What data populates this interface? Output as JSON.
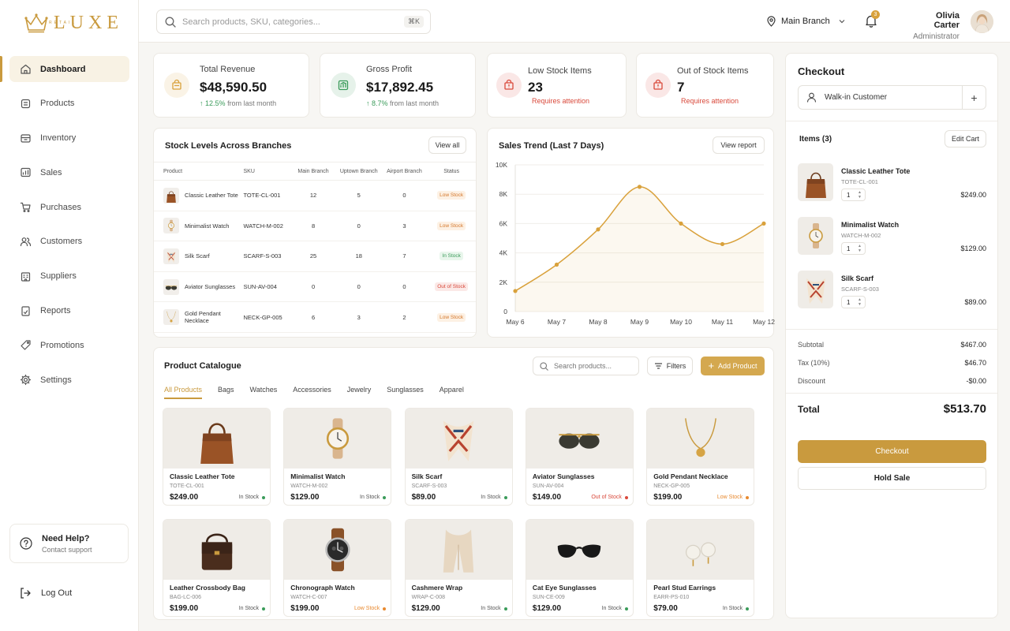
{
  "brand": {
    "name": "LUXE",
    "sub": "RETAIL",
    "color": "#c99a3e"
  },
  "sidebar": {
    "items": [
      {
        "label": "Dashboard",
        "icon": "home-icon",
        "active": true
      },
      {
        "label": "Products",
        "icon": "box-icon"
      },
      {
        "label": "Inventory",
        "icon": "inventory-icon"
      },
      {
        "label": "Sales",
        "icon": "sales-icon"
      },
      {
        "label": "Purchases",
        "icon": "cart-icon"
      },
      {
        "label": "Customers",
        "icon": "users-icon"
      },
      {
        "label": "Suppliers",
        "icon": "building-icon"
      },
      {
        "label": "Reports",
        "icon": "report-icon"
      },
      {
        "label": "Promotions",
        "icon": "tag-icon"
      },
      {
        "label": "Settings",
        "icon": "gear-icon"
      }
    ],
    "help_title": "Need Help?",
    "help_sub": "Contact support",
    "logout": "Log Out"
  },
  "topbar": {
    "search_placeholder": "Search products, SKU, categories...",
    "shortcut": "⌘K",
    "branch": "Main Branch",
    "notifications": "3",
    "user_name": "Olivia Carter",
    "user_role": "Administrator"
  },
  "kpis": [
    {
      "label": "Total Revenue",
      "value": "$48,590.50",
      "change": "12.5%",
      "change_text": "from last month",
      "color": "#d9a13b"
    },
    {
      "label": "Gross Profit",
      "value": "$17,892.45",
      "change": "8.7%",
      "change_text": "from last month",
      "color": "#3a9b5a"
    },
    {
      "label": "Low Stock Items",
      "value": "23",
      "warn": "Requires attention",
      "color": "#d9493b"
    },
    {
      "label": "Out of Stock Items",
      "value": "7",
      "warn": "Requires attention",
      "color": "#d9493b"
    }
  ],
  "stock": {
    "title": "Stock Levels Across Branches",
    "view_all": "View all",
    "headers": [
      "Product",
      "SKU",
      "Main Branch",
      "Uptown Branch",
      "Airport Branch",
      "Status"
    ],
    "rows": [
      {
        "product": "Classic Leather Tote",
        "sku": "TOTE-CL-001",
        "main": "12",
        "uptown": "5",
        "airport": "0",
        "status": "Low Stock",
        "kind": "low",
        "icon": "tote-icon"
      },
      {
        "product": "Minimalist Watch",
        "sku": "WATCH-M-002",
        "main": "8",
        "uptown": "0",
        "airport": "3",
        "status": "Low Stock",
        "kind": "low",
        "icon": "watch-icon"
      },
      {
        "product": "Silk Scarf",
        "sku": "SCARF-S-003",
        "main": "25",
        "uptown": "18",
        "airport": "7",
        "status": "In Stock",
        "kind": "in",
        "icon": "scarf-icon"
      },
      {
        "product": "Aviator Sunglasses",
        "sku": "SUN-AV-004",
        "main": "0",
        "uptown": "0",
        "airport": "0",
        "status": "Out of Stock",
        "kind": "out",
        "icon": "sunglasses-icon"
      },
      {
        "product": "Gold Pendant Necklace",
        "sku": "NECK-GP-005",
        "main": "6",
        "uptown": "3",
        "airport": "2",
        "status": "Low Stock",
        "kind": "low",
        "icon": "necklace-icon"
      }
    ]
  },
  "trend": {
    "title": "Sales Trend (Last 7 Days)",
    "view_report": "View report"
  },
  "chart_data": {
    "type": "line",
    "title": "Sales Trend (Last 7 Days)",
    "categories": [
      "May 6",
      "May 7",
      "May 8",
      "May 9",
      "May 10",
      "May 11",
      "May 12"
    ],
    "values": [
      1400,
      3200,
      5600,
      8500,
      6000,
      4600,
      6000
    ],
    "y_ticks": [
      "0",
      "2K",
      "4K",
      "6K",
      "8K",
      "10K"
    ],
    "ylim": [
      0,
      10000
    ],
    "color": "#d9a13b",
    "grid": true
  },
  "catalogue": {
    "title": "Product Catalogue",
    "search_placeholder": "Search products...",
    "filters": "Filters",
    "add": "Add Product",
    "tabs": [
      "All Products",
      "Bags",
      "Watches",
      "Accessories",
      "Jewelry",
      "Sunglasses",
      "Apparel"
    ],
    "products": [
      {
        "name": "Classic Leather Tote",
        "sku": "TOTE-CL-001",
        "price": "$249.00",
        "status": "In Stock",
        "kind": "in",
        "icon": "tote-icon"
      },
      {
        "name": "Minimalist Watch",
        "sku": "WATCH-M-002",
        "price": "$129.00",
        "status": "In Stock",
        "kind": "in",
        "icon": "watch-icon"
      },
      {
        "name": "Silk Scarf",
        "sku": "SCARF-S-003",
        "price": "$89.00",
        "status": "In Stock",
        "kind": "in",
        "icon": "scarf-icon"
      },
      {
        "name": "Aviator Sunglasses",
        "sku": "SUN-AV-004",
        "price": "$149.00",
        "status": "Out of Stock",
        "kind": "out",
        "icon": "sunglasses-icon"
      },
      {
        "name": "Gold Pendant Necklace",
        "sku": "NECK-GP-005",
        "price": "$199.00",
        "status": "Low Stock",
        "kind": "low",
        "icon": "necklace-icon"
      },
      {
        "name": "Leather Crossbody Bag",
        "sku": "BAG-LC-006",
        "price": "$199.00",
        "status": "In Stock",
        "kind": "in",
        "icon": "crossbody-bag-icon"
      },
      {
        "name": "Chronograph Watch",
        "sku": "WATCH-C-007",
        "price": "$199.00",
        "status": "Low Stock",
        "kind": "low",
        "icon": "chronograph-icon"
      },
      {
        "name": "Cashmere Wrap",
        "sku": "WRAP-C-008",
        "price": "$129.00",
        "status": "In Stock",
        "kind": "in",
        "icon": "wrap-icon"
      },
      {
        "name": "Cat Eye Sunglasses",
        "sku": "SUN-CE-009",
        "price": "$129.00",
        "status": "In Stock",
        "kind": "in",
        "icon": "cat-eye-icon"
      },
      {
        "name": "Pearl Stud Earrings",
        "sku": "EARR-PS-010",
        "price": "$79.00",
        "status": "In Stock",
        "kind": "in",
        "icon": "earrings-icon"
      }
    ]
  },
  "checkout": {
    "title": "Checkout",
    "customer": "Walk-in Customer",
    "items_label": "Items (3)",
    "edit_cart": "Edit Cart",
    "items": [
      {
        "name": "Classic Leather Tote",
        "sku": "TOTE-CL-001",
        "qty": "1",
        "price": "$249.00",
        "icon": "tote-icon"
      },
      {
        "name": "Minimalist Watch",
        "sku": "WATCH-M-002",
        "qty": "1",
        "price": "$129.00",
        "icon": "watch-icon"
      },
      {
        "name": "Silk Scarf",
        "sku": "SCARF-S-003",
        "qty": "1",
        "price": "$89.00",
        "icon": "scarf-icon"
      }
    ],
    "subtotal_label": "Subtotal",
    "subtotal": "$467.00",
    "tax_label": "Tax (10%)",
    "tax": "$46.70",
    "discount_label": "Discount",
    "discount": "-$0.00",
    "total_label": "Total",
    "total": "$513.70",
    "checkout_btn": "Checkout",
    "hold_btn": "Hold Sale"
  },
  "status_colors": {
    "in": "#3a9b5a",
    "low": "#e8892f",
    "out": "#d9493b"
  }
}
